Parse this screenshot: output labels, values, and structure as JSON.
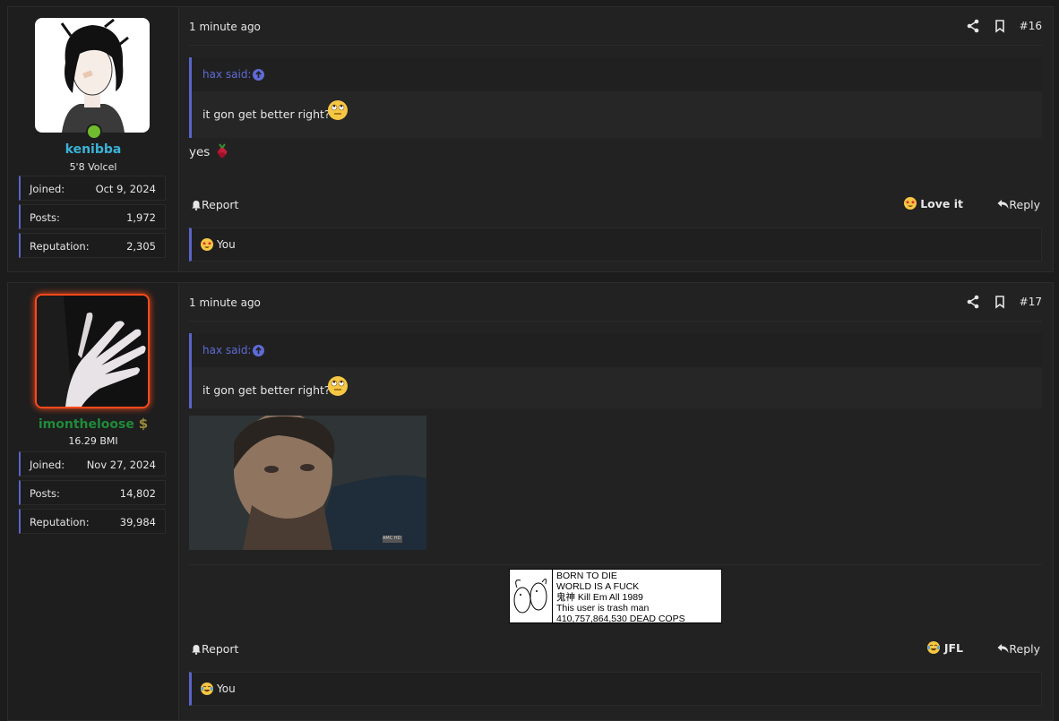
{
  "posts": [
    {
      "user": {
        "name": "kenibba",
        "name_color": "#3ab3d6",
        "title": "5'8 Volcel",
        "online": true,
        "stats": [
          {
            "label": "Joined:",
            "value": "Oct 9, 2024"
          },
          {
            "label": "Posts:",
            "value": "1,972"
          },
          {
            "label": "Reputation:",
            "value": "2,305"
          }
        ]
      },
      "time": "1 minute ago",
      "number": "#16",
      "quote": {
        "author": "hax said:",
        "text": "it gon get better right?!",
        "emoji": "rolling-eyes-emoji"
      },
      "body_text": "yes",
      "body_emoji": "raspberry-icon",
      "report_label": "Report",
      "reaction_label": "Love it",
      "reaction_emoji": "star-struck-emoji",
      "reply_label": "Reply",
      "reactions_summary": "You"
    },
    {
      "user": {
        "name": "imontheloose",
        "name_color": "#1f8a3a",
        "title": "16.29 BMI",
        "stats": [
          {
            "label": "Joined:",
            "value": "Nov 27, 2024"
          },
          {
            "label": "Posts:",
            "value": "14,802"
          },
          {
            "label": "Reputation:",
            "value": "39,984"
          }
        ]
      },
      "time": "1 minute ago",
      "number": "#17",
      "quote": {
        "author": "hax said:",
        "text": "it gon get better right?!",
        "emoji": "rolling-eyes-emoji"
      },
      "gif_badge": "AMC HD",
      "signature": {
        "lines": [
          "BORN TO DIE",
          "WORLD IS A FUCK",
          "鬼神 Kill Em All 1989",
          "This user is trash man",
          "410,757,864,530 DEAD COPS"
        ]
      },
      "report_label": "Report",
      "reaction_label": "JFL",
      "reaction_emoji": "laughing-crying-emoji",
      "reply_label": "Reply",
      "reactions_summary": "You"
    }
  ],
  "colors": {
    "accent": "#5865c8",
    "quote_author": "#5e6bd6",
    "online": "#6fbd2f"
  }
}
